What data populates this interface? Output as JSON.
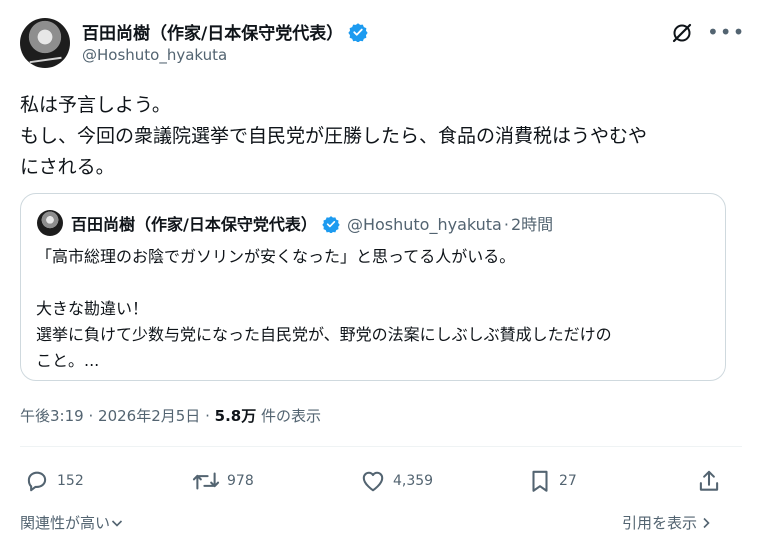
{
  "author": {
    "display_name": "百田尚樹（作家/日本保守党代表）",
    "handle": "@Hoshuto_hyakuta",
    "verified_color": "#1d9bf0"
  },
  "tweet": {
    "text": "私は予言しよう。\nもし、今回の衆議院選挙で自民党が圧勝したら、食品の消費税はうやむや\nにされる。"
  },
  "quoted_tweet": {
    "display_name": "百田尚樹（作家/日本保守党代表）",
    "handle": "@Hoshuto_hyakuta",
    "separator": "·",
    "time": "2時間",
    "text": "「高市総理のお陰でガソリンが安くなった」と思ってる人がいる。\n\n大きな勘違い！\n選挙に負けて少数与党になった自民党が、野党の法案にしぶしぶ賛成しただけの\nこと。..."
  },
  "meta": {
    "time": "午後3:19",
    "separator": "·",
    "date": "2026年2月5日",
    "views": "5.8万",
    "views_label": "件の表示"
  },
  "actions": {
    "replies": "152",
    "reposts": "978",
    "likes": "4,359",
    "bookmarks": "27"
  },
  "footer": {
    "sort_label": "関連性が高い",
    "quotes_label": "引用を表示"
  },
  "icons": {
    "verified": "verified-badge-icon",
    "grok": "grok-icon",
    "more": "more-icon",
    "reply": "reply-icon",
    "repost": "repost-icon",
    "like": "heart-icon",
    "bookmark": "bookmark-icon",
    "share": "share-icon",
    "sort": "chevron-down-icon",
    "quotes": "chevron-right-icon"
  }
}
